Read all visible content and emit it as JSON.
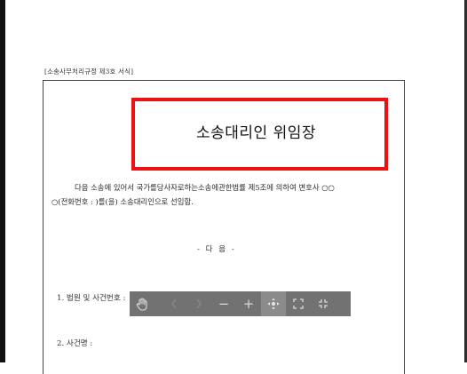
{
  "document": {
    "form_label": "[소송사무처리규정 제3호 서식]",
    "title": "소송대리인 위임장",
    "paragraph_line1": "다음 소송에 있어서 국가를당사자로하는소송에관한법률 제5조에 의하여 변호사 ○○",
    "paragraph_line2": "○(전화번호 :                )를(을) 소송대리인으로 선임함.",
    "subheading": "- 다  음 -",
    "item1": "1. 법원 및 사건번호 :",
    "item2": "2. 사건명 :"
  },
  "toolbar": {
    "buttons": [
      {
        "name": "pan-hand",
        "icon": "hand-icon"
      },
      {
        "name": "previous-page",
        "icon": "chevron-left-icon"
      },
      {
        "name": "next-page",
        "icon": "chevron-right-icon"
      },
      {
        "name": "zoom-out",
        "icon": "minus-icon",
        "glyph": "−"
      },
      {
        "name": "zoom-in",
        "icon": "plus-icon",
        "glyph": "+"
      },
      {
        "name": "move",
        "icon": "move-icon"
      },
      {
        "name": "fullscreen",
        "icon": "expand-icon"
      },
      {
        "name": "exit-fullscreen",
        "icon": "collapse-icon"
      }
    ]
  },
  "colors": {
    "highlight_border": "#ee1111",
    "toolbar_bg": "#5f5f5f"
  }
}
